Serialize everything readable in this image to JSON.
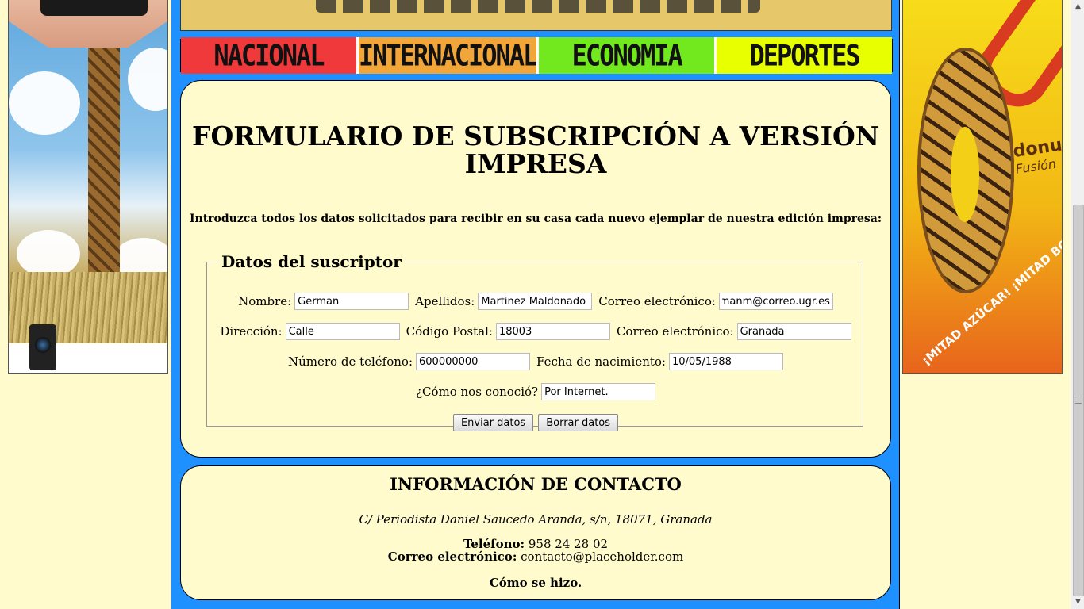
{
  "nav": {
    "items": [
      {
        "label": "NACIONAL",
        "color": "#f0393a"
      },
      {
        "label": "INTERNACIONAL",
        "color": "#f2a63a"
      },
      {
        "label": "ECONOMIA",
        "color": "#72e81e"
      },
      {
        "label": "DEPORTES",
        "color": "#e8ff00"
      }
    ]
  },
  "form": {
    "title": "FORMULARIO DE SUBSCRIPCIÓN A VERSIÓN IMPRESA",
    "intro": "Introduzca todos los datos solicitados para recibir en su casa cada nuevo ejemplar de nuestra edición impresa:",
    "legend": "Datos del suscriptor",
    "fields": {
      "nombre": {
        "label": "Nombre:",
        "value": "German"
      },
      "apellidos": {
        "label": "Apellidos:",
        "value": "Martinez Maldonado"
      },
      "correo": {
        "label": "Correo electrónico:",
        "value": "ermanm@correo.ugr.es"
      },
      "direccion": {
        "label": "Dirección:",
        "value": "Calle"
      },
      "codigo_postal": {
        "label": "Código Postal:",
        "value": "18003"
      },
      "correo2": {
        "label": "Correo electrónico:",
        "value": "Granada"
      },
      "telefono": {
        "label": "Número de teléfono:",
        "value": "600000000"
      },
      "nacimiento": {
        "label": "Fecha de nacimiento:",
        "value": "10/05/1988"
      },
      "como": {
        "label": "¿Cómo nos conoció?",
        "value": "Por Internet."
      }
    },
    "submit_label": "Enviar datos",
    "reset_label": "Borrar datos"
  },
  "contact": {
    "title": "INFORMACIÓN DE CONTACTO",
    "address": "C/ Periodista Daniel Saucedo Aranda, s/n, 18071, Granada",
    "phone_label": "Teléfono:",
    "phone": "958 24 28 02",
    "email_label": "Correo electrónico:",
    "email": "contacto@placeholder.com",
    "howto": "Cómo se hizo."
  },
  "ads": {
    "right_brand": "donuts",
    "right_brand_sub": "Fusión",
    "right_slogan": "¡MITAD AZÚCAR! ¡MITAD BOMBÓN!"
  },
  "colors": {
    "page_background": "#fffbcc",
    "main_border": "#1e90ff"
  }
}
